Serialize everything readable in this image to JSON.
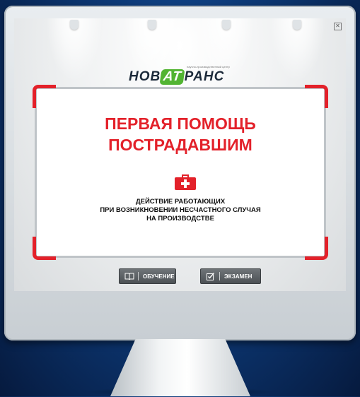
{
  "logo": {
    "text_before": "НОВ",
    "text_highlight": "АТ",
    "text_after": "РАНС",
    "tagline": "научно-производственный центр",
    "accent_color": "#52b432"
  },
  "card": {
    "title_line1": "ПЕРВАЯ ПОМОЩЬ",
    "title_line2": "ПОСТРАДАВШИМ",
    "icon": "first-aid-kit-icon",
    "subtitle_line1": "ДЕЙСТВИЕ РАБОТАЮЩИХ",
    "subtitle_line2": "ПРИ ВОЗНИКНОВЕНИИ НЕСЧАСТНОГО СЛУЧАЯ",
    "subtitle_line3": "НА ПРОИЗВОДСТВЕ",
    "accent_color": "#e3212a"
  },
  "buttons": {
    "learn_label": "ОБУЧЕНИЕ",
    "learn_icon": "book-icon",
    "exam_label": "ЭКЗАМЕН",
    "exam_icon": "checkbox-icon"
  },
  "window": {
    "close_glyph": "✕"
  }
}
